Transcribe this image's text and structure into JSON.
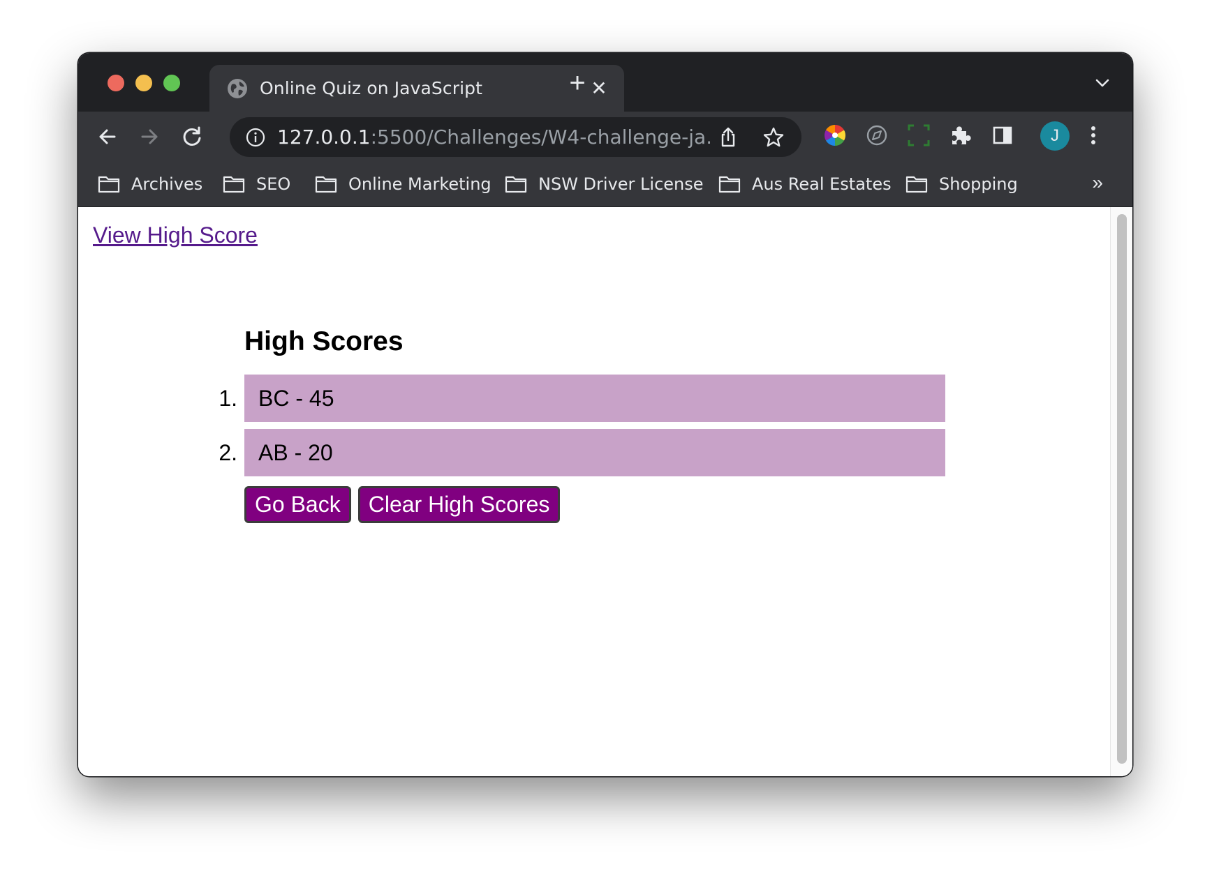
{
  "browser": {
    "tab_title": "Online Quiz on JavaScript",
    "tab_close": "✕",
    "new_tab": "+",
    "url_host": "127.0.0.1",
    "url_path": ":5500/Challenges/W4-challenge-ja...",
    "avatar_letter": "J",
    "bookmarks_overflow": "»",
    "bookmarks": [
      {
        "label": "Archives"
      },
      {
        "label": "SEO"
      },
      {
        "label": "Online Marketing"
      },
      {
        "label": "NSW Driver License"
      },
      {
        "label": "Aus Real Estates"
      },
      {
        "label": "Shopping"
      }
    ]
  },
  "page": {
    "view_high_score_link": "View High Score",
    "heading": "High Scores",
    "scores": [
      {
        "rank": "1.",
        "text": "BC - 45"
      },
      {
        "rank": "2.",
        "text": "AB - 20"
      }
    ],
    "go_back_label": "Go Back",
    "clear_label": "Clear High Scores"
  },
  "colors": {
    "score_row_bg": "#c8a2c8",
    "button_bg": "#800080",
    "link": "#551a8b"
  }
}
